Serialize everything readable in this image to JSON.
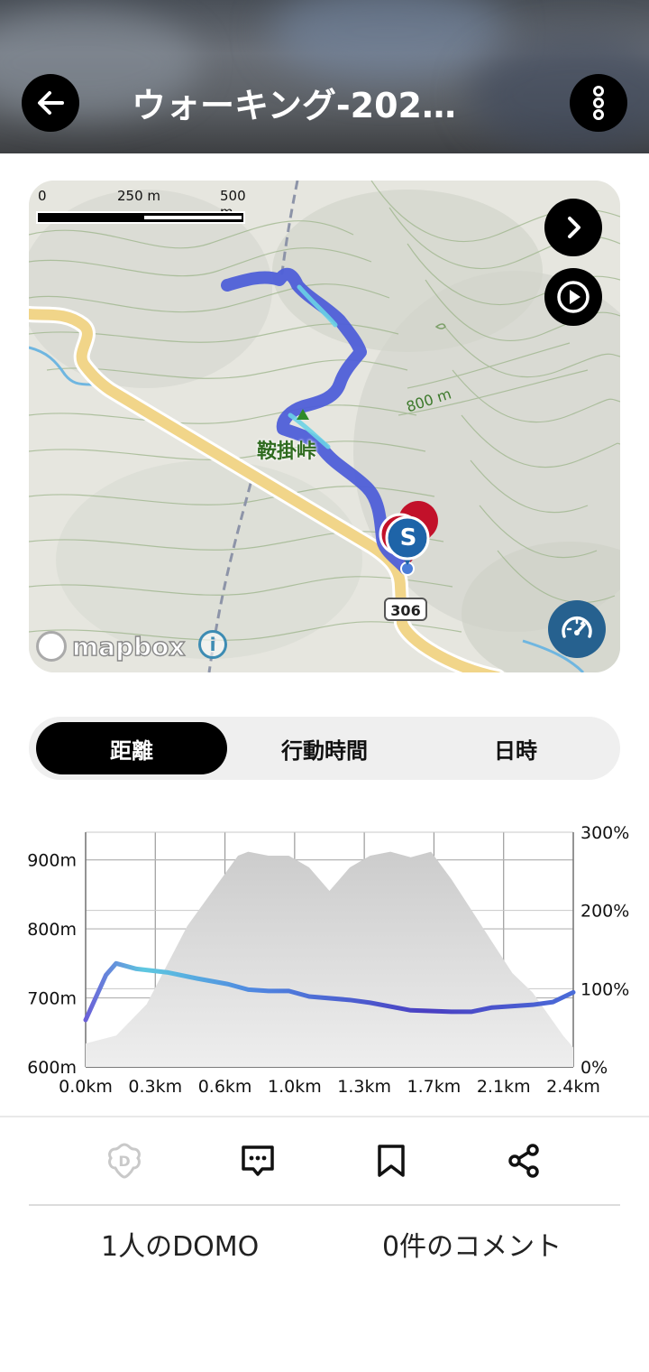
{
  "header": {
    "title": "ウォーキング-202…",
    "back_icon": "arrow-left-icon",
    "menu_icon": "more-vertical-icon"
  },
  "map": {
    "scale": {
      "labels": [
        "0",
        "250 m",
        "500 m"
      ]
    },
    "pass_name": "鞍掛峠",
    "contour_label": "800 m",
    "road_number": "306",
    "attribution": "mapbox",
    "start_marker": "S",
    "buttons": {
      "next_icon": "chevron-right-icon",
      "play_icon": "play-icon",
      "speed_icon": "speedometer-icon",
      "info_icon": "info-icon"
    }
  },
  "tabs": {
    "items": [
      "距離",
      "行動時間",
      "日時"
    ],
    "active": 0
  },
  "chart_data": {
    "type": "area",
    "x_ticks": [
      "0.0km",
      "0.3km",
      "0.6km",
      "1.0km",
      "1.3km",
      "1.7km",
      "2.1km",
      "2.4km"
    ],
    "y_left_ticks": [
      "900m",
      "800m",
      "700m",
      "600m"
    ],
    "y_right_ticks": [
      "300%",
      "200%",
      "100%",
      "0%"
    ],
    "ylim_left": [
      600,
      940
    ],
    "ylim_right": [
      0,
      300
    ],
    "xlim": [
      0,
      2.4
    ],
    "grid": true,
    "series": [
      {
        "kind": "line",
        "axis": "left",
        "colors": [
          "#6b5fd8",
          "#5ec8e0",
          "#3a4fc7"
        ],
        "x": [
          0.0,
          0.1,
          0.15,
          0.25,
          0.4,
          0.55,
          0.7,
          0.8,
          0.9,
          1.0,
          1.1,
          1.3,
          1.4,
          1.6,
          1.8,
          1.9,
          2.0,
          2.2,
          2.3,
          2.4
        ],
        "y": [
          668,
          733,
          750,
          742,
          737,
          728,
          720,
          712,
          710,
          710,
          702,
          697,
          693,
          682,
          680,
          680,
          686,
          690,
          694,
          708
        ]
      },
      {
        "kind": "area",
        "axis": "right",
        "x": [
          0.0,
          0.15,
          0.3,
          0.5,
          0.75,
          0.8,
          0.9,
          1.0,
          1.1,
          1.2,
          1.3,
          1.4,
          1.5,
          1.6,
          1.7,
          1.8,
          1.9,
          2.0,
          2.1,
          2.2,
          2.35,
          2.4
        ],
        "y": [
          30,
          40,
          80,
          180,
          270,
          275,
          270,
          270,
          255,
          225,
          255,
          270,
          275,
          268,
          275,
          240,
          200,
          160,
          120,
          95,
          40,
          25
        ]
      }
    ]
  },
  "actions": {
    "domo_icon": "domo-icon",
    "comment_icon": "comment-icon",
    "bookmark_icon": "bookmark-icon",
    "share_icon": "share-icon",
    "domo_count_text": "1人のDOMO",
    "comment_count_text": "0件のコメント"
  }
}
